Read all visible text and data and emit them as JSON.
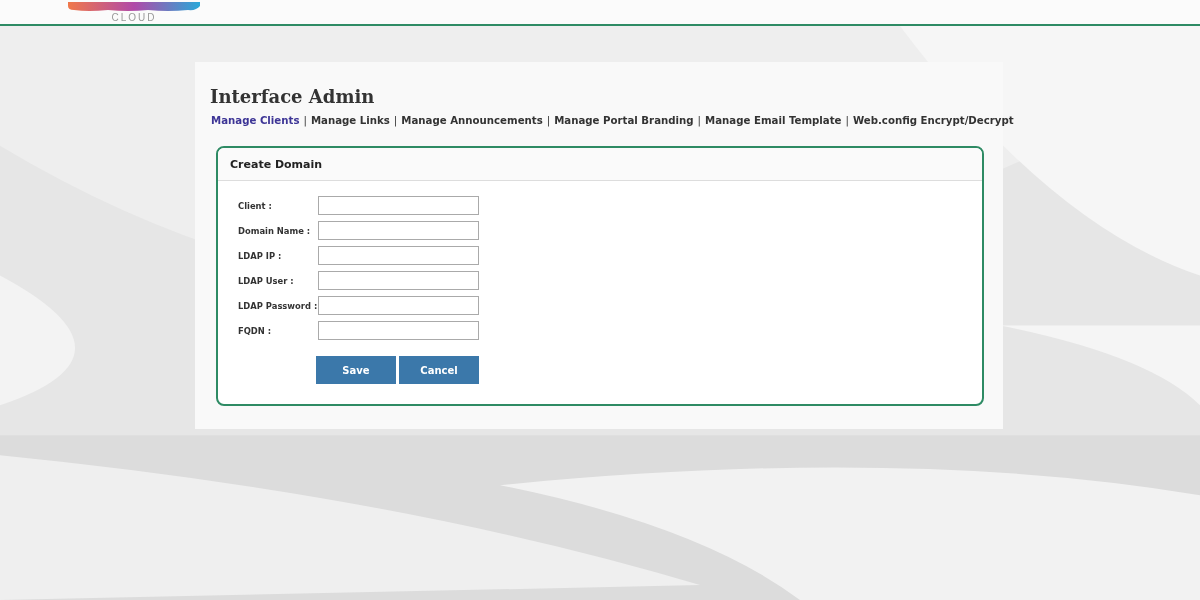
{
  "header": {
    "logo_subtitle": "CLOUD"
  },
  "page": {
    "title": "Interface Admin"
  },
  "nav_separator": "|",
  "nav_links": [
    {
      "label": "Manage Clients",
      "selected": true
    },
    {
      "label": "Manage Links",
      "selected": false
    },
    {
      "label": "Manage Announcements",
      "selected": false
    },
    {
      "label": "Manage Portal Branding",
      "selected": false
    },
    {
      "label": "Manage Email Template",
      "selected": false
    },
    {
      "label": "Web.config Encrypt/Decrypt",
      "selected": false
    }
  ],
  "panel": {
    "title": "Create Domain"
  },
  "fields": [
    {
      "label": "Client :"
    },
    {
      "label": "Domain Name :"
    },
    {
      "label": "LDAP IP :"
    },
    {
      "label": "LDAP User :"
    },
    {
      "label": "LDAP Password :"
    },
    {
      "label": "FQDN :"
    }
  ],
  "buttons": [
    "Save",
    "Cancel"
  ]
}
